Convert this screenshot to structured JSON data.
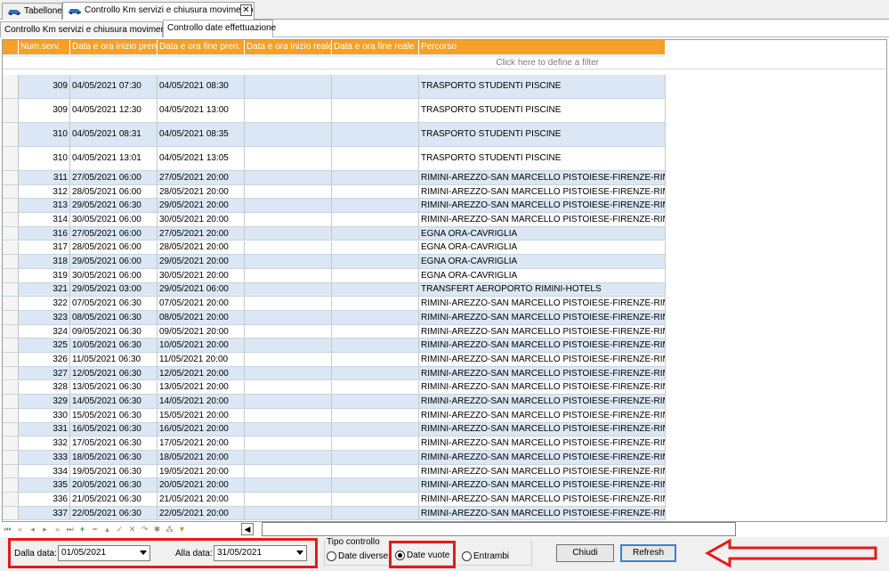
{
  "doc_tabs": [
    {
      "label": "Tabellone"
    },
    {
      "label": "Controllo Km servizi e chiusura movimento"
    }
  ],
  "sub_tabs": [
    {
      "label": "Controllo Km servizi e chiusura movimento"
    },
    {
      "label": "Controllo date effettuazione"
    }
  ],
  "grid": {
    "columns": [
      "Num.serv.",
      "Data e ora inizio pren.",
      "Data e ora fine pren.",
      "Data e ora inizio reale",
      "Data e ora fine reale",
      "Percorso"
    ],
    "filter_hint": "Click here to define a filter",
    "rows": [
      [
        "309",
        "04/05/2021 07:30",
        "04/05/2021 08:30",
        "",
        "",
        "TRASPORTO STUDENTI PISCINE"
      ],
      [
        "309",
        "04/05/2021 12:30",
        "04/05/2021 13:00",
        "",
        "",
        "TRASPORTO STUDENTI PISCINE"
      ],
      [
        "310",
        "04/05/2021 08:31",
        "04/05/2021 08:35",
        "",
        "",
        "TRASPORTO STUDENTI PISCINE"
      ],
      [
        "310",
        "04/05/2021 13:01",
        "04/05/2021 13:05",
        "",
        "",
        "TRASPORTO STUDENTI PISCINE"
      ],
      [
        "311",
        "27/05/2021 06:00",
        "27/05/2021 20:00",
        "",
        "",
        "RIMINI-AREZZO-SAN MARCELLO PISTOIESE-FIRENZE-RIMINI"
      ],
      [
        "312",
        "28/05/2021 06:00",
        "28/05/2021 20:00",
        "",
        "",
        "RIMINI-AREZZO-SAN MARCELLO PISTOIESE-FIRENZE-RIMINI"
      ],
      [
        "313",
        "29/05/2021 06:30",
        "29/05/2021 20:00",
        "",
        "",
        "RIMINI-AREZZO-SAN MARCELLO PISTOIESE-FIRENZE-RIMINI"
      ],
      [
        "314",
        "30/05/2021 06:00",
        "30/05/2021 20:00",
        "",
        "",
        "RIMINI-AREZZO-SAN MARCELLO PISTOIESE-FIRENZE-RIMINI"
      ],
      [
        "316",
        "27/05/2021 06:00",
        "27/05/2021 20:00",
        "",
        "",
        "EGNA ORA-CAVRIGLIA"
      ],
      [
        "317",
        "28/05/2021 06:00",
        "28/05/2021 20:00",
        "",
        "",
        "EGNA ORA-CAVRIGLIA"
      ],
      [
        "318",
        "29/05/2021 06:00",
        "29/05/2021 20:00",
        "",
        "",
        "EGNA ORA-CAVRIGLIA"
      ],
      [
        "319",
        "30/05/2021 06:00",
        "30/05/2021 20:00",
        "",
        "",
        "EGNA ORA-CAVRIGLIA"
      ],
      [
        "321",
        "29/05/2021 03:00",
        "29/05/2021 06:00",
        "",
        "",
        "TRANSFERT AEROPORTO RIMINI-HOTELS"
      ],
      [
        "322",
        "07/05/2021 06:30",
        "07/05/2021 20:00",
        "",
        "",
        "RIMINI-AREZZO-SAN MARCELLO PISTOIESE-FIRENZE-RIMINI"
      ],
      [
        "323",
        "08/05/2021 06:30",
        "08/05/2021 20:00",
        "",
        "",
        "RIMINI-AREZZO-SAN MARCELLO PISTOIESE-FIRENZE-RIMINI"
      ],
      [
        "324",
        "09/05/2021 06:30",
        "09/05/2021 20:00",
        "",
        "",
        "RIMINI-AREZZO-SAN MARCELLO PISTOIESE-FIRENZE-RIMINI"
      ],
      [
        "325",
        "10/05/2021 06:30",
        "10/05/2021 20:00",
        "",
        "",
        "RIMINI-AREZZO-SAN MARCELLO PISTOIESE-FIRENZE-RIMINI"
      ],
      [
        "326",
        "11/05/2021 06:30",
        "11/05/2021 20:00",
        "",
        "",
        "RIMINI-AREZZO-SAN MARCELLO PISTOIESE-FIRENZE-RIMINI"
      ],
      [
        "327",
        "12/05/2021 06:30",
        "12/05/2021 20:00",
        "",
        "",
        "RIMINI-AREZZO-SAN MARCELLO PISTOIESE-FIRENZE-RIMINI"
      ],
      [
        "328",
        "13/05/2021 06:30",
        "13/05/2021 20:00",
        "",
        "",
        "RIMINI-AREZZO-SAN MARCELLO PISTOIESE-FIRENZE-RIMINI"
      ],
      [
        "329",
        "14/05/2021 06:30",
        "14/05/2021 20:00",
        "",
        "",
        "RIMINI-AREZZO-SAN MARCELLO PISTOIESE-FIRENZE-RIMINI"
      ],
      [
        "330",
        "15/05/2021 06:30",
        "15/05/2021 20:00",
        "",
        "",
        "RIMINI-AREZZO-SAN MARCELLO PISTOIESE-FIRENZE-RIMINI"
      ],
      [
        "331",
        "16/05/2021 06:30",
        "16/05/2021 20:00",
        "",
        "",
        "RIMINI-AREZZO-SAN MARCELLO PISTOIESE-FIRENZE-RIMINI"
      ],
      [
        "332",
        "17/05/2021 06:30",
        "17/05/2021 20:00",
        "",
        "",
        "RIMINI-AREZZO-SAN MARCELLO PISTOIESE-FIRENZE-RIMINI"
      ],
      [
        "333",
        "18/05/2021 06:30",
        "18/05/2021 20:00",
        "",
        "",
        "RIMINI-AREZZO-SAN MARCELLO PISTOIESE-FIRENZE-RIMINI"
      ],
      [
        "334",
        "19/05/2021 06:30",
        "19/05/2021 20:00",
        "",
        "",
        "RIMINI-AREZZO-SAN MARCELLO PISTOIESE-FIRENZE-RIMINI"
      ],
      [
        "335",
        "20/05/2021 06:30",
        "20/05/2021 20:00",
        "",
        "",
        "RIMINI-AREZZO-SAN MARCELLO PISTOIESE-FIRENZE-RIMINI"
      ],
      [
        "336",
        "21/05/2021 06:30",
        "21/05/2021 20:00",
        "",
        "",
        "RIMINI-AREZZO-SAN MARCELLO PISTOIESE-FIRENZE-RIMINI"
      ],
      [
        "337",
        "22/05/2021 06:30",
        "22/05/2021 20:00",
        "",
        "",
        "RIMINI-AREZZO-SAN MARCELLO PISTOIESE-FIRENZE-RIMINI"
      ]
    ]
  },
  "navigator": {
    "icons": [
      "first-icon",
      "prev-page-icon",
      "prev-icon",
      "next-icon",
      "next-page-icon",
      "last-icon",
      "add-icon",
      "delete-icon",
      "edit-icon",
      "save-icon",
      "cancel-icon",
      "refresh-icon",
      "bookmark-icon",
      "filter-clear-icon",
      "filter-icon"
    ]
  },
  "filters": {
    "from_label": "Dalla data:",
    "from_value": "01/05/2021",
    "to_label": "Alla data:",
    "to_value": "31/05/2021",
    "tipo_label": "Tipo controllo",
    "options": [
      {
        "label": "Date diverse",
        "selected": false
      },
      {
        "label": "Date vuote",
        "selected": true
      },
      {
        "label": "Entrambi",
        "selected": false
      }
    ]
  },
  "buttons": {
    "close_label": "Chiudi",
    "refresh_label": "Refresh"
  },
  "colors": {
    "header": "#f7a027",
    "alt_row": "#dbe7f4",
    "highlight": "#e31a1a"
  }
}
